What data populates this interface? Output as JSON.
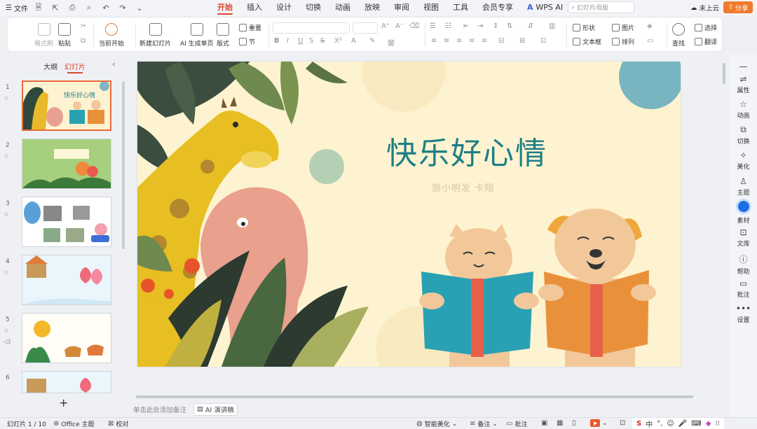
{
  "menu": {
    "file": "文件",
    "tabs": [
      "开始",
      "插入",
      "设计",
      "切换",
      "动画",
      "放映",
      "审阅",
      "视图",
      "工具",
      "会员专享"
    ],
    "wps_ai": "WPS AI",
    "search_placeholder": "幻灯片母版",
    "cloud": "未上云",
    "share": "分享"
  },
  "ribbon": {
    "format_painter": "格式刷",
    "paste": "粘贴",
    "from_current": "当前开始",
    "new_slide": "新建幻灯片",
    "ai_single": "AI 生成单页",
    "layout": "版式",
    "reset": "重置",
    "section": "节",
    "shape": "形状",
    "picture": "图片",
    "textbox": "文本框",
    "arrange": "排列",
    "find": "查找",
    "select": "选择",
    "translate": "翻译"
  },
  "left_panel": {
    "tab_outline": "大纲",
    "tab_slides": "幻灯片",
    "slide_numbers": [
      "1",
      "2",
      "3",
      "4",
      "5",
      "6"
    ],
    "thumb1_title": "快乐好心情"
  },
  "slide": {
    "title": "快乐好心情",
    "subtitle": "狼小明发 卡翔"
  },
  "notes": {
    "placeholder": "单击此处添加备注",
    "ai_speech": "AI 演讲稿"
  },
  "right_bar": [
    "属性",
    "动画",
    "切换",
    "美化",
    "主题",
    "素材",
    "文库",
    "帮助",
    "批注",
    "设置"
  ],
  "status": {
    "slide_count": "幻灯片 1 / 10",
    "theme": "Office 主题",
    "proofread": "校对",
    "smart_beautify": "智能美化",
    "notes": "备注",
    "comments": "批注",
    "ime": [
      "中",
      "°,",
      "☺",
      "🎤"
    ]
  }
}
